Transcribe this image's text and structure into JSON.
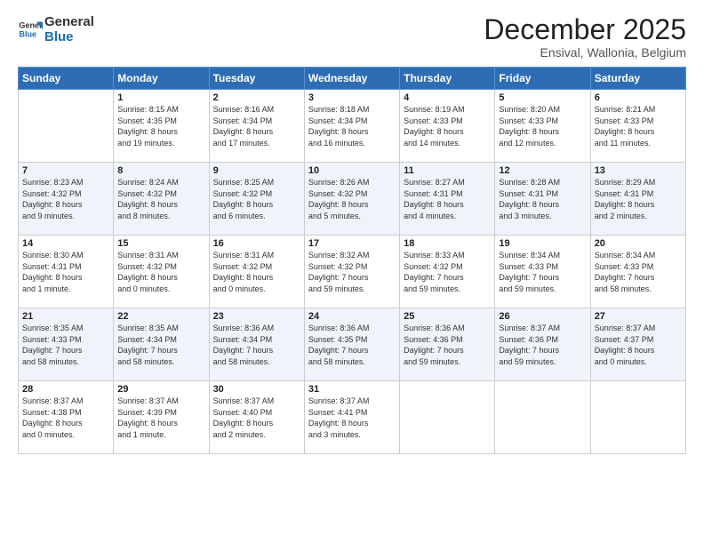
{
  "logo": {
    "line1": "General",
    "line2": "Blue"
  },
  "title": "December 2025",
  "subtitle": "Ensival, Wallonia, Belgium",
  "headers": [
    "Sunday",
    "Monday",
    "Tuesday",
    "Wednesday",
    "Thursday",
    "Friday",
    "Saturday"
  ],
  "weeks": [
    [
      {
        "num": "",
        "lines": []
      },
      {
        "num": "1",
        "lines": [
          "Sunrise: 8:15 AM",
          "Sunset: 4:35 PM",
          "Daylight: 8 hours",
          "and 19 minutes."
        ]
      },
      {
        "num": "2",
        "lines": [
          "Sunrise: 8:16 AM",
          "Sunset: 4:34 PM",
          "Daylight: 8 hours",
          "and 17 minutes."
        ]
      },
      {
        "num": "3",
        "lines": [
          "Sunrise: 8:18 AM",
          "Sunset: 4:34 PM",
          "Daylight: 8 hours",
          "and 16 minutes."
        ]
      },
      {
        "num": "4",
        "lines": [
          "Sunrise: 8:19 AM",
          "Sunset: 4:33 PM",
          "Daylight: 8 hours",
          "and 14 minutes."
        ]
      },
      {
        "num": "5",
        "lines": [
          "Sunrise: 8:20 AM",
          "Sunset: 4:33 PM",
          "Daylight: 8 hours",
          "and 12 minutes."
        ]
      },
      {
        "num": "6",
        "lines": [
          "Sunrise: 8:21 AM",
          "Sunset: 4:33 PM",
          "Daylight: 8 hours",
          "and 11 minutes."
        ]
      }
    ],
    [
      {
        "num": "7",
        "lines": [
          "Sunrise: 8:23 AM",
          "Sunset: 4:32 PM",
          "Daylight: 8 hours",
          "and 9 minutes."
        ]
      },
      {
        "num": "8",
        "lines": [
          "Sunrise: 8:24 AM",
          "Sunset: 4:32 PM",
          "Daylight: 8 hours",
          "and 8 minutes."
        ]
      },
      {
        "num": "9",
        "lines": [
          "Sunrise: 8:25 AM",
          "Sunset: 4:32 PM",
          "Daylight: 8 hours",
          "and 6 minutes."
        ]
      },
      {
        "num": "10",
        "lines": [
          "Sunrise: 8:26 AM",
          "Sunset: 4:32 PM",
          "Daylight: 8 hours",
          "and 5 minutes."
        ]
      },
      {
        "num": "11",
        "lines": [
          "Sunrise: 8:27 AM",
          "Sunset: 4:31 PM",
          "Daylight: 8 hours",
          "and 4 minutes."
        ]
      },
      {
        "num": "12",
        "lines": [
          "Sunrise: 8:28 AM",
          "Sunset: 4:31 PM",
          "Daylight: 8 hours",
          "and 3 minutes."
        ]
      },
      {
        "num": "13",
        "lines": [
          "Sunrise: 8:29 AM",
          "Sunset: 4:31 PM",
          "Daylight: 8 hours",
          "and 2 minutes."
        ]
      }
    ],
    [
      {
        "num": "14",
        "lines": [
          "Sunrise: 8:30 AM",
          "Sunset: 4:31 PM",
          "Daylight: 8 hours",
          "and 1 minute."
        ]
      },
      {
        "num": "15",
        "lines": [
          "Sunrise: 8:31 AM",
          "Sunset: 4:32 PM",
          "Daylight: 8 hours",
          "and 0 minutes."
        ]
      },
      {
        "num": "16",
        "lines": [
          "Sunrise: 8:31 AM",
          "Sunset: 4:32 PM",
          "Daylight: 8 hours",
          "and 0 minutes."
        ]
      },
      {
        "num": "17",
        "lines": [
          "Sunrise: 8:32 AM",
          "Sunset: 4:32 PM",
          "Daylight: 7 hours",
          "and 59 minutes."
        ]
      },
      {
        "num": "18",
        "lines": [
          "Sunrise: 8:33 AM",
          "Sunset: 4:32 PM",
          "Daylight: 7 hours",
          "and 59 minutes."
        ]
      },
      {
        "num": "19",
        "lines": [
          "Sunrise: 8:34 AM",
          "Sunset: 4:33 PM",
          "Daylight: 7 hours",
          "and 59 minutes."
        ]
      },
      {
        "num": "20",
        "lines": [
          "Sunrise: 8:34 AM",
          "Sunset: 4:33 PM",
          "Daylight: 7 hours",
          "and 58 minutes."
        ]
      }
    ],
    [
      {
        "num": "21",
        "lines": [
          "Sunrise: 8:35 AM",
          "Sunset: 4:33 PM",
          "Daylight: 7 hours",
          "and 58 minutes."
        ]
      },
      {
        "num": "22",
        "lines": [
          "Sunrise: 8:35 AM",
          "Sunset: 4:34 PM",
          "Daylight: 7 hours",
          "and 58 minutes."
        ]
      },
      {
        "num": "23",
        "lines": [
          "Sunrise: 8:36 AM",
          "Sunset: 4:34 PM",
          "Daylight: 7 hours",
          "and 58 minutes."
        ]
      },
      {
        "num": "24",
        "lines": [
          "Sunrise: 8:36 AM",
          "Sunset: 4:35 PM",
          "Daylight: 7 hours",
          "and 58 minutes."
        ]
      },
      {
        "num": "25",
        "lines": [
          "Sunrise: 8:36 AM",
          "Sunset: 4:36 PM",
          "Daylight: 7 hours",
          "and 59 minutes."
        ]
      },
      {
        "num": "26",
        "lines": [
          "Sunrise: 8:37 AM",
          "Sunset: 4:36 PM",
          "Daylight: 7 hours",
          "and 59 minutes."
        ]
      },
      {
        "num": "27",
        "lines": [
          "Sunrise: 8:37 AM",
          "Sunset: 4:37 PM",
          "Daylight: 8 hours",
          "and 0 minutes."
        ]
      }
    ],
    [
      {
        "num": "28",
        "lines": [
          "Sunrise: 8:37 AM",
          "Sunset: 4:38 PM",
          "Daylight: 8 hours",
          "and 0 minutes."
        ]
      },
      {
        "num": "29",
        "lines": [
          "Sunrise: 8:37 AM",
          "Sunset: 4:39 PM",
          "Daylight: 8 hours",
          "and 1 minute."
        ]
      },
      {
        "num": "30",
        "lines": [
          "Sunrise: 8:37 AM",
          "Sunset: 4:40 PM",
          "Daylight: 8 hours",
          "and 2 minutes."
        ]
      },
      {
        "num": "31",
        "lines": [
          "Sunrise: 8:37 AM",
          "Sunset: 4:41 PM",
          "Daylight: 8 hours",
          "and 3 minutes."
        ]
      },
      {
        "num": "",
        "lines": []
      },
      {
        "num": "",
        "lines": []
      },
      {
        "num": "",
        "lines": []
      }
    ]
  ]
}
